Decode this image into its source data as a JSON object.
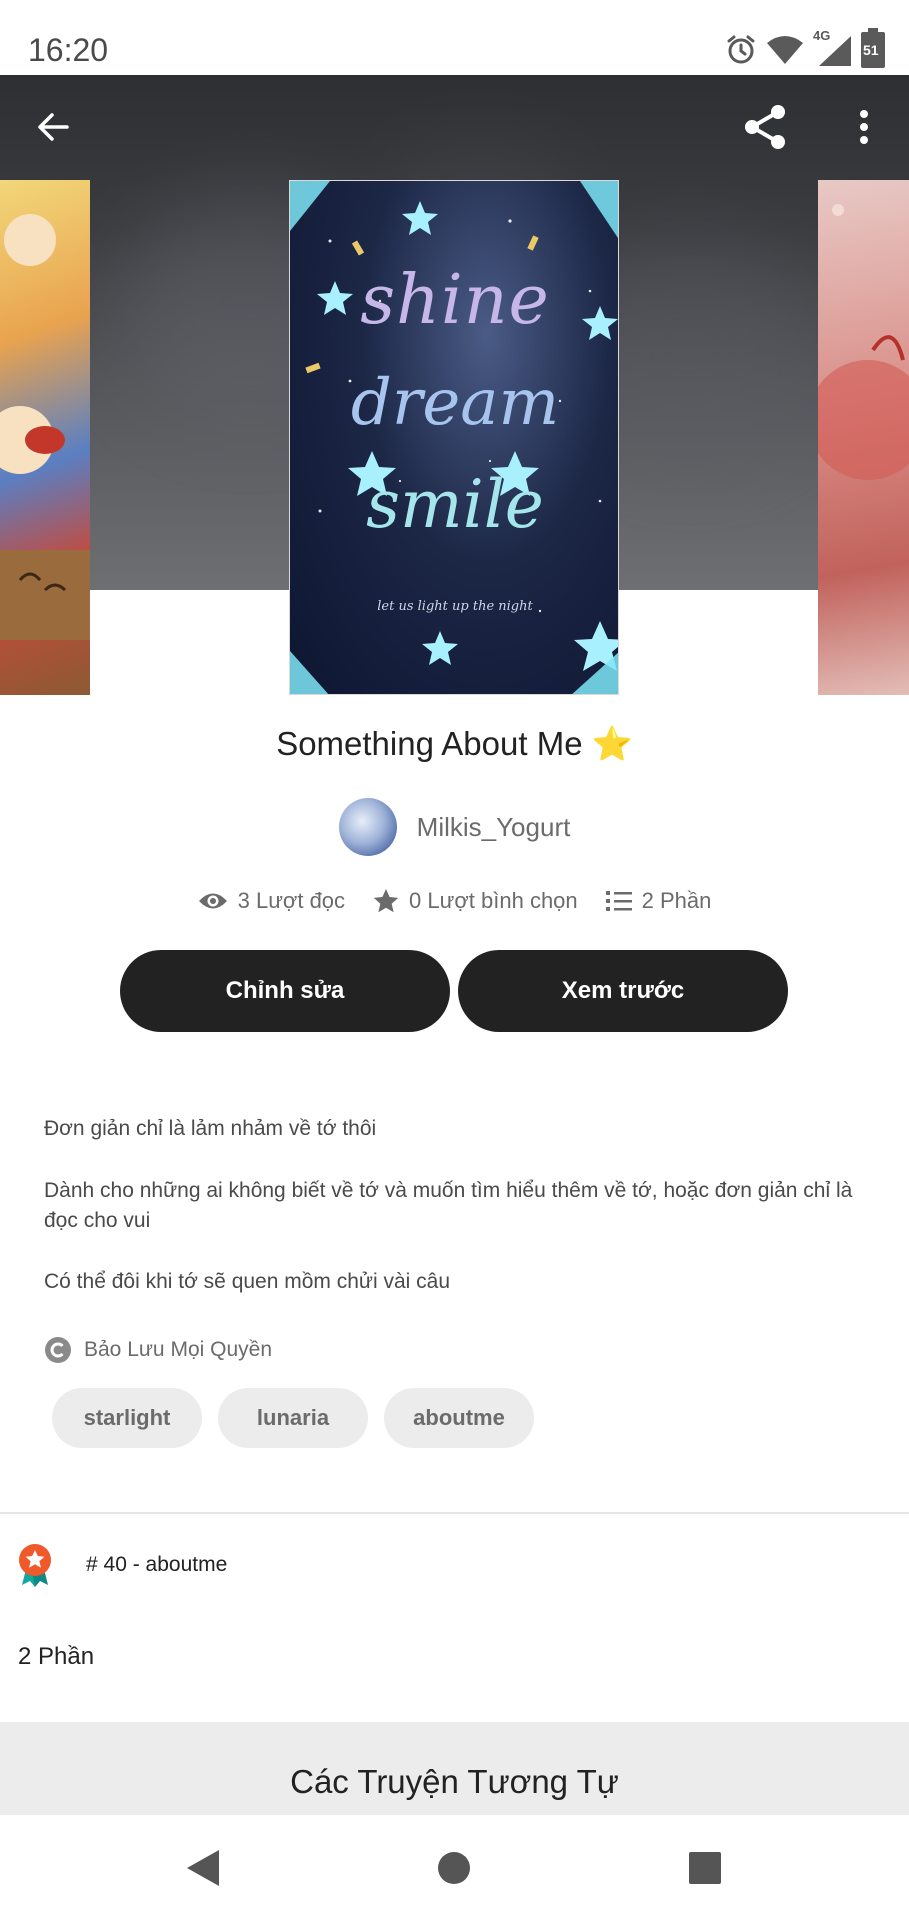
{
  "status_bar": {
    "time": "16:20",
    "network_label": "4G",
    "battery_level": "51",
    "icons": [
      "alarm-icon",
      "wifi-icon",
      "cell-signal-icon",
      "battery-icon"
    ]
  },
  "toolbar": {
    "back_icon": "arrow-left-icon",
    "share_icon": "share-icon",
    "more_icon": "more-vertical-icon"
  },
  "story": {
    "title": "Something About Me ⭐",
    "author": "Milkis_Yogurt",
    "stats": {
      "reads": "3 Lượt đọc",
      "votes": "0 Lượt bình chọn",
      "parts": "2 Phần"
    },
    "cover_text": [
      "shine",
      "dream",
      "smile"
    ],
    "cover_tagline": "let us light up the night",
    "buttons": {
      "edit": "Chỉnh sửa",
      "preview": "Xem trước"
    },
    "description": [
      "Đơn giản chỉ là lảm nhảm về tớ thôi",
      "Dành cho những ai không biết về tớ và muốn tìm hiểu thêm về tớ, hoặc đơn giản chỉ là đọc cho vui",
      "Có thể đôi khi tớ sẽ quen mồm chửi vài câu"
    ],
    "copyright": "Bảo Lưu Mọi Quyền",
    "tags": [
      "starlight",
      "lunaria",
      "aboutme"
    ],
    "ranking": "# 40 - aboutme",
    "parts_heading": "2 Phần"
  },
  "similar_section": {
    "title": "Các Truyện Tương Tự"
  },
  "colors": {
    "button_bg": "#222222",
    "tag_bg": "#ececec",
    "rank_badge": "#f0592a",
    "rank_ribbon": "#13a89e"
  }
}
